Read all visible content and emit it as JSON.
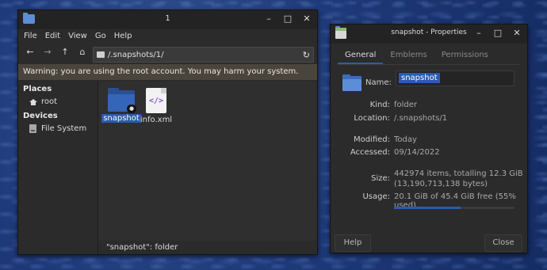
{
  "file_manager": {
    "title": "1",
    "menu": [
      "File",
      "Edit",
      "View",
      "Go",
      "Help"
    ],
    "path": "/.snapshots/1/",
    "warning": "Warning: you are using the root account. You may harm your system.",
    "sidebar": {
      "places_header": "Places",
      "places": [
        {
          "label": "root",
          "icon": "home-icon"
        }
      ],
      "devices_header": "Devices",
      "devices": [
        {
          "label": "File System",
          "icon": "drive-icon"
        }
      ]
    },
    "files": [
      {
        "name": "snapshot",
        "icon": "folder-locked-icon",
        "selected": true
      },
      {
        "name": "info.xml",
        "icon": "xml-file-icon",
        "selected": false
      }
    ],
    "status": "\"snapshot\": folder"
  },
  "properties": {
    "title": "snapshot - Properties",
    "tabs": [
      "General",
      "Emblems",
      "Permissions"
    ],
    "active_tab": "General",
    "name_label": "Name:",
    "name_value": "snapshot",
    "kind_label": "Kind:",
    "kind_value": "folder",
    "location_label": "Location:",
    "location_value": "/.snapshots/1",
    "modified_label": "Modified:",
    "modified_value": "Today",
    "accessed_label": "Accessed:",
    "accessed_value": "09/14/2022",
    "size_label": "Size:",
    "size_value_line1": "442974 items, totalling 12.3 GiB",
    "size_value_line2": "(13,190,713,138 bytes)",
    "usage_label": "Usage:",
    "usage_value": "20.1 GiB of 45.4 GiB free (55% used)",
    "usage_fraction": 0.55,
    "help_button": "Help",
    "close_button": "Close"
  },
  "colors": {
    "accent": "#2a5bb0",
    "folder": "#3465b8"
  }
}
